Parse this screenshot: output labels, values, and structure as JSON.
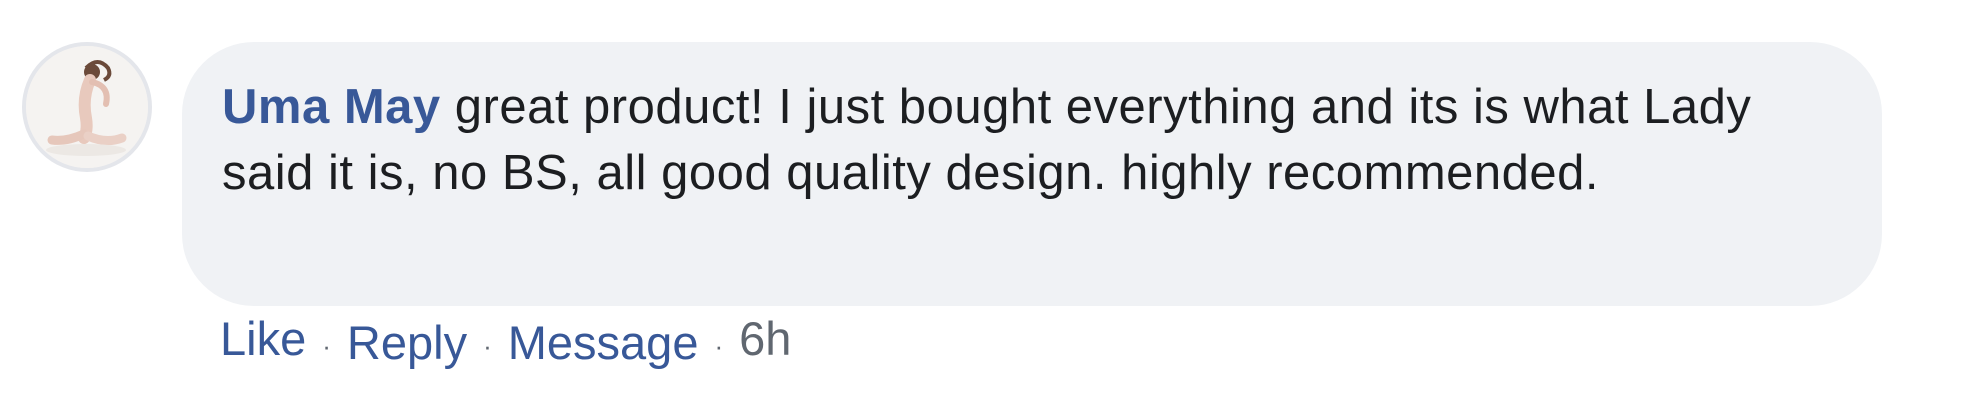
{
  "comment": {
    "author": "Uma May",
    "text": " great product! I just bought everything and its is what Lady said it is, no BS, all good quality design. highly recommended.",
    "avatar_icon": "avatar-photo",
    "actions": {
      "like": "Like",
      "reply": "Reply",
      "message": "Message",
      "separator": "·",
      "timestamp": "6h"
    }
  },
  "colors": {
    "link": "#385898",
    "bubble_bg": "#f0f2f5",
    "text": "#1c1e21",
    "muted": "#606770"
  }
}
